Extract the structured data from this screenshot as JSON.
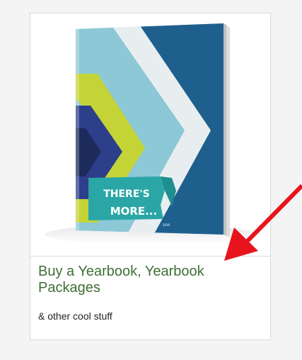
{
  "card": {
    "title": "Buy a Yearbook, Yearbook Packages",
    "subtitle": "& other cool stuff",
    "image": {
      "cover_text_line1": "THERE'S",
      "cover_text_line2": "MORE...",
      "cover_year": "2016"
    }
  },
  "colors": {
    "page_background": "#f4f4f4",
    "card_background": "#ffffff",
    "card_border": "#d9d9d9",
    "title_color": "#3f6f36",
    "subtitle_color": "#222222",
    "cover_dark_blue": "#1f5f8e",
    "cover_light_blue": "#8cc8d6",
    "cover_lime": "#c4d437",
    "cover_navy": "#2d3f8a",
    "cover_teal_banner": "#2aa6a6",
    "arrow_red": "#e8141c"
  },
  "icons": {
    "annotation_arrow": "red-arrow-icon"
  }
}
